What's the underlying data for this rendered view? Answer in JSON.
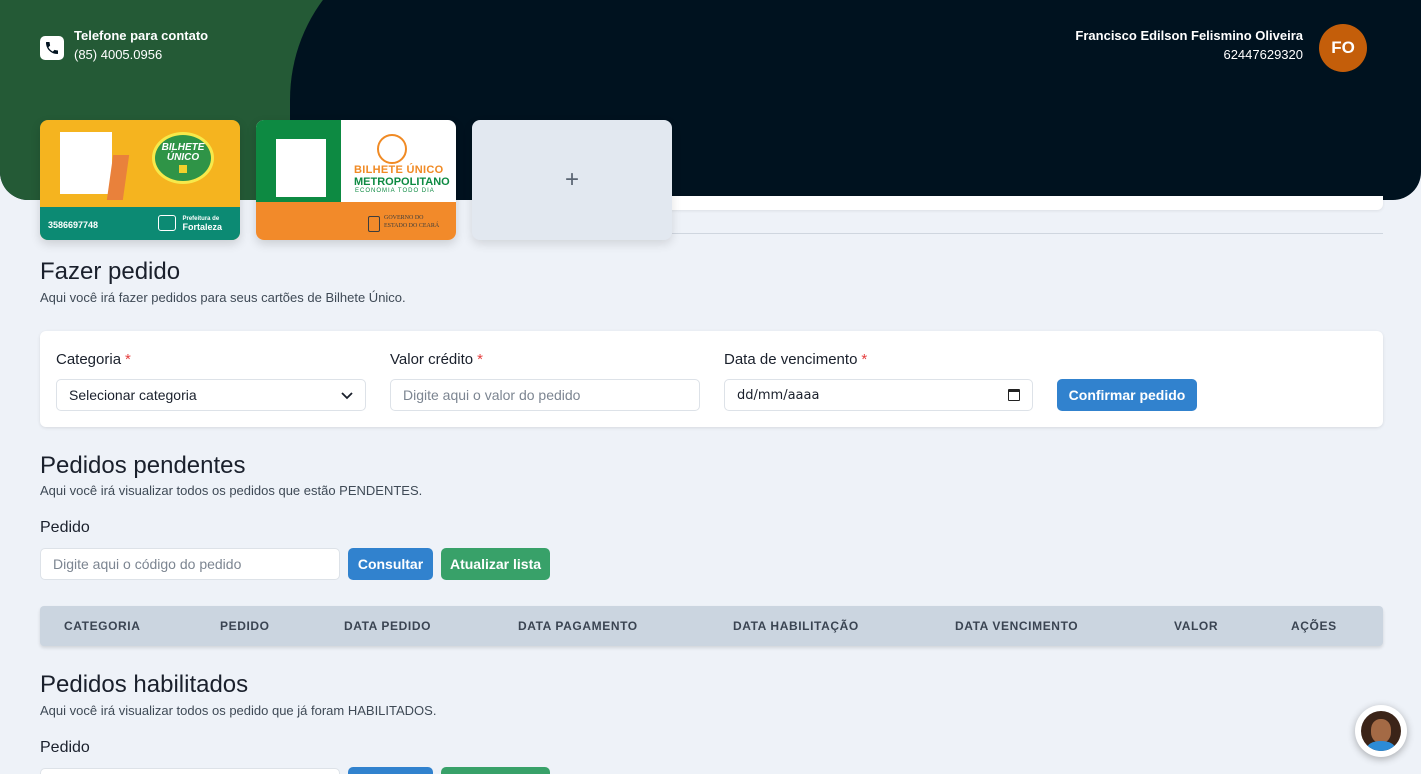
{
  "header": {
    "contact_title": "Telefone para contato",
    "contact_number": "(85) 4005.0956",
    "user_name": "Francisco Edilson Felismino Oliveira",
    "user_id": "62447629320",
    "avatar_initials": "FO",
    "avatar_color": "#c45e0a"
  },
  "cards": [
    {
      "logo_line1": "BILHETE",
      "logo_line2": "ÚNICO",
      "number": "3586697748",
      "issuer_small": "Prefeitura de",
      "issuer": "Fortaleza"
    },
    {
      "line1": "BILHETE ÚNICO",
      "line2": "METROPOLITANO",
      "line3": "ECONOMIA TODO DIA",
      "issuer_line1": "GOVERNO DO",
      "issuer_line2": "ESTADO DO CEARÁ"
    }
  ],
  "add_card_symbol": "+",
  "order": {
    "title": "Fazer pedido",
    "description": "Aqui você irá fazer pedidos para seus cartões de Bilhete Único.",
    "category_label": "Categoria",
    "category_value": "Selecionar categoria",
    "credit_label": "Valor crédito",
    "credit_placeholder": "Digite aqui o valor do pedido",
    "due_label": "Data de vencimento",
    "due_value": "dd/mm/aaaa",
    "required_mark": "*",
    "confirm_label": "Confirmar pedido"
  },
  "pending": {
    "title": "Pedidos pendentes",
    "description": "Aqui você irá visualizar todos os pedidos que estão PENDENTES.",
    "field_label": "Pedido",
    "field_placeholder": "Digite aqui o código do pedido",
    "consult_label": "Consultar",
    "refresh_label": "Atualizar lista",
    "columns": [
      "CATEGORIA",
      "PEDIDO",
      "DATA PEDIDO",
      "DATA PAGAMENTO",
      "DATA HABILITAÇÃO",
      "DATA VENCIMENTO",
      "VALOR",
      "AÇÕES"
    ]
  },
  "enabled": {
    "title": "Pedidos habilitados",
    "description": "Aqui você irá visualizar todos os pedido que já foram HABILITADOS.",
    "field_label": "Pedido"
  },
  "colors": {
    "header_bg": "#00121f",
    "header_green": "#245a36",
    "primary_button": "#3182ce",
    "success_button": "#38a169",
    "table_header": "#cbd5e0"
  }
}
